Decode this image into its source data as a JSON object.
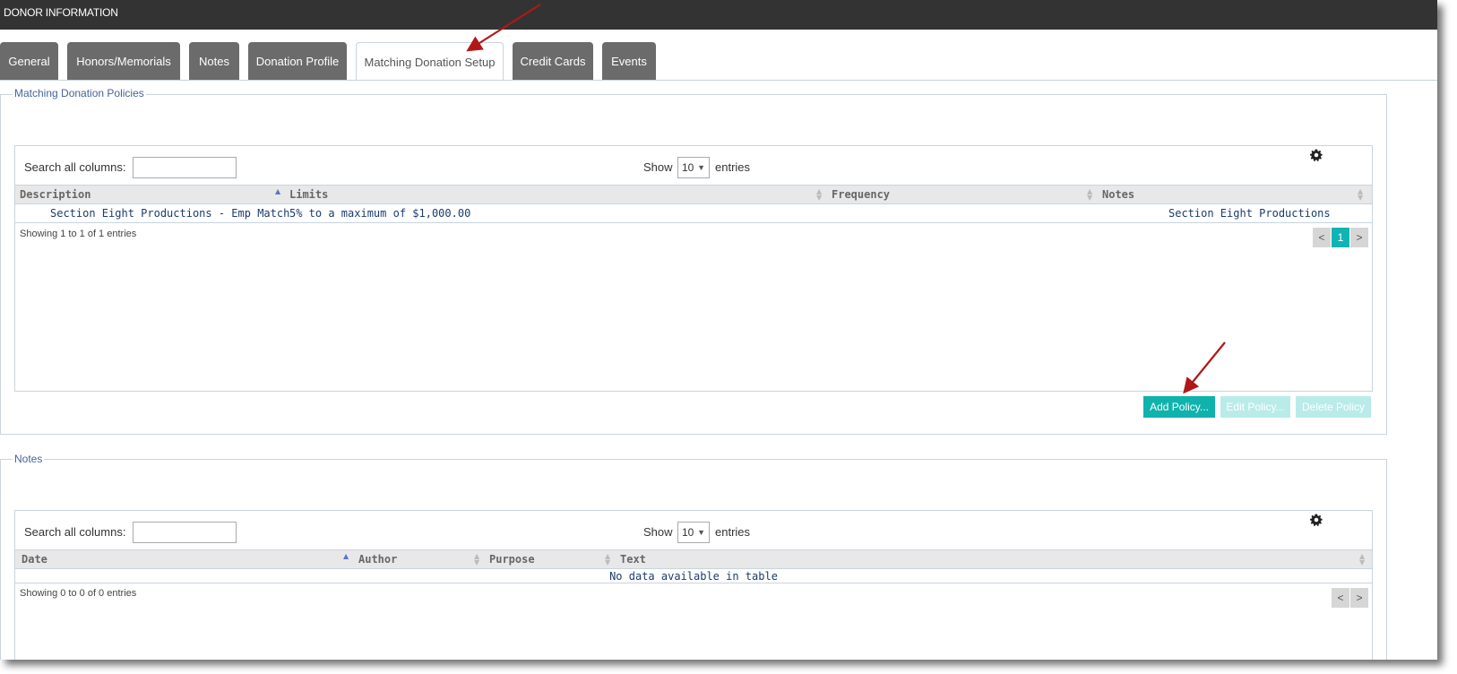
{
  "window": {
    "title": "DONOR INFORMATION"
  },
  "tabs": [
    {
      "label": "General"
    },
    {
      "label": "Honors/Memorials"
    },
    {
      "label": "Notes"
    },
    {
      "label": "Donation Profile"
    },
    {
      "label": "Matching Donation Setup",
      "active": true
    },
    {
      "label": "Credit Cards"
    },
    {
      "label": "Events"
    }
  ],
  "policies": {
    "legend": "Matching Donation Policies",
    "search_label": "Search all columns:",
    "search_value": "",
    "show_label": "Show",
    "page_size": "10",
    "entries_label": "entries",
    "columns": [
      "Description",
      "Limits",
      "Frequency",
      "Notes"
    ],
    "rows": [
      {
        "description": "Section Eight Productions - Emp Match",
        "limits": "5% to a maximum of $1,000.00",
        "frequency": "",
        "notes": "Section Eight Productions"
      }
    ],
    "info": "Showing 1 to 1 of 1 entries",
    "pagination": {
      "prev": "<",
      "current": "1",
      "next": ">"
    },
    "buttons": {
      "add": "Add Policy...",
      "edit": "Edit Policy...",
      "delete": "Delete Policy"
    }
  },
  "notes": {
    "legend": "Notes",
    "search_label": "Search all columns:",
    "search_value": "",
    "show_label": "Show",
    "page_size": "10",
    "entries_label": "entries",
    "columns": [
      "Date",
      "Author",
      "Purpose",
      "Text"
    ],
    "empty_message": "No data available in table",
    "info": "Showing 0 to 0 of 0 entries",
    "pagination": {
      "prev": "<",
      "next": ">"
    }
  },
  "colors": {
    "accent": "#10b2ac",
    "titlebar": "#333333",
    "tab": "#6b6b6b",
    "annotation_arrow": "#b01818"
  }
}
